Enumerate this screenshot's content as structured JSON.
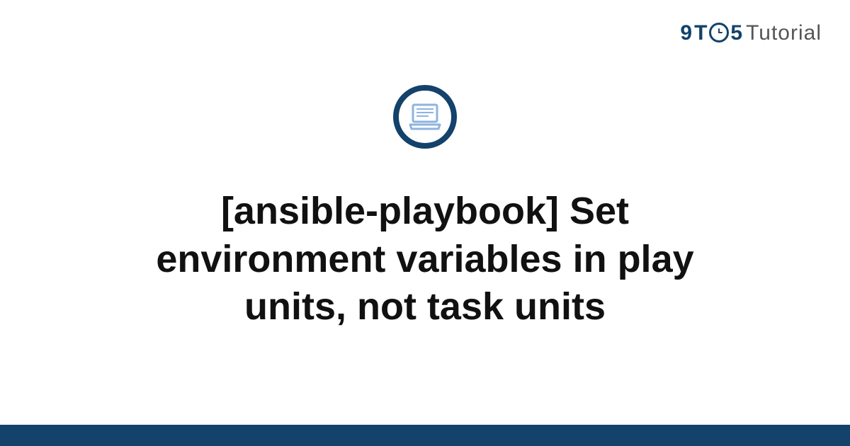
{
  "brand": {
    "nine": "9",
    "t": "T",
    "clock_glyph": "☉",
    "five": "5",
    "tutorial": "Tutorial"
  },
  "hero": {
    "icon_name": "laptop-icon"
  },
  "title": "[ansible-playbook] Set environment variables in play units, not task units",
  "colors": {
    "primary": "#13426b",
    "accent": "#8fb3e0"
  }
}
